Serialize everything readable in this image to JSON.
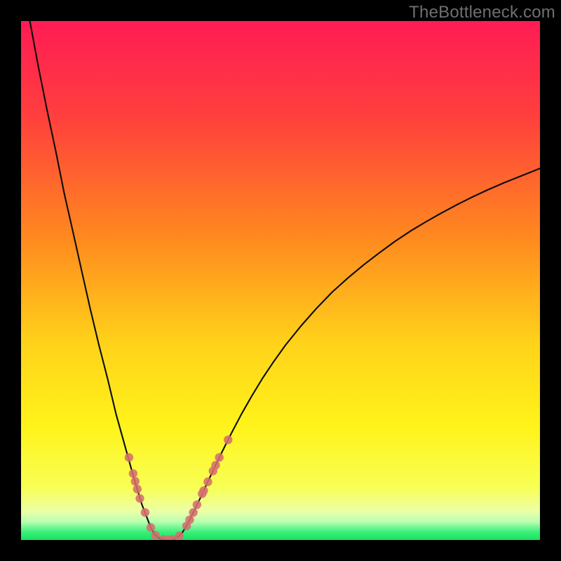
{
  "watermark": "TheBottleneck.com",
  "colors": {
    "bg_black": "#000000",
    "curve": "#0c0c0c",
    "dot": "#d56e6e",
    "green_band": "#1be25d",
    "watermark": "#6f6f6f",
    "gradient_stops": [
      {
        "offset": 0.0,
        "color": "#ff1c55"
      },
      {
        "offset": 0.18,
        "color": "#ff3e3d"
      },
      {
        "offset": 0.42,
        "color": "#ff8a1f"
      },
      {
        "offset": 0.62,
        "color": "#ffd21a"
      },
      {
        "offset": 0.78,
        "color": "#fff31a"
      },
      {
        "offset": 0.9,
        "color": "#f8ff55"
      },
      {
        "offset": 0.945,
        "color": "#ecffa8"
      },
      {
        "offset": 0.965,
        "color": "#b8ffb0"
      },
      {
        "offset": 0.985,
        "color": "#37f07a"
      },
      {
        "offset": 1.0,
        "color": "#1be25d"
      }
    ]
  },
  "chart_data": {
    "type": "line",
    "title": "",
    "xlabel": "",
    "ylabel": "",
    "x": [
      0.0,
      0.017,
      0.033,
      0.05,
      0.067,
      0.083,
      0.1,
      0.117,
      0.133,
      0.15,
      0.167,
      0.183,
      0.2,
      0.217,
      0.233,
      0.25,
      0.258,
      0.267,
      0.275,
      0.283,
      0.292,
      0.3,
      0.31,
      0.32,
      0.33,
      0.345,
      0.365,
      0.385,
      0.405,
      0.425,
      0.445,
      0.465,
      0.485,
      0.51,
      0.54,
      0.57,
      0.6,
      0.63,
      0.66,
      0.69,
      0.72,
      0.75,
      0.78,
      0.81,
      0.84,
      0.87,
      0.9,
      0.93,
      0.96,
      1.0
    ],
    "y_bottleneck": [
      1.09,
      1.0,
      0.914,
      0.829,
      0.749,
      0.669,
      0.594,
      0.518,
      0.447,
      0.376,
      0.31,
      0.243,
      0.182,
      0.121,
      0.068,
      0.024,
      0.01,
      0.003,
      0.001,
      0.0,
      0.001,
      0.004,
      0.013,
      0.029,
      0.049,
      0.08,
      0.123,
      0.165,
      0.205,
      0.243,
      0.278,
      0.311,
      0.341,
      0.376,
      0.413,
      0.447,
      0.478,
      0.505,
      0.53,
      0.553,
      0.575,
      0.595,
      0.613,
      0.63,
      0.646,
      0.661,
      0.675,
      0.688,
      0.7,
      0.716
    ],
    "xlim": [
      0,
      1
    ],
    "ylim": [
      0,
      1
    ],
    "optimum_x": 0.283,
    "scatter_points": [
      {
        "x": 0.208,
        "y": 0.159
      },
      {
        "x": 0.216,
        "y": 0.128
      },
      {
        "x": 0.22,
        "y": 0.113
      },
      {
        "x": 0.224,
        "y": 0.098
      },
      {
        "x": 0.229,
        "y": 0.08
      },
      {
        "x": 0.239,
        "y": 0.053
      },
      {
        "x": 0.25,
        "y": 0.024
      },
      {
        "x": 0.259,
        "y": 0.009
      },
      {
        "x": 0.274,
        "y": 0.001
      },
      {
        "x": 0.283,
        "y": 0.0
      },
      {
        "x": 0.292,
        "y": 0.001
      },
      {
        "x": 0.305,
        "y": 0.008
      },
      {
        "x": 0.319,
        "y": 0.027
      },
      {
        "x": 0.325,
        "y": 0.039
      },
      {
        "x": 0.332,
        "y": 0.053
      },
      {
        "x": 0.339,
        "y": 0.068
      },
      {
        "x": 0.349,
        "y": 0.089
      },
      {
        "x": 0.352,
        "y": 0.095
      },
      {
        "x": 0.36,
        "y": 0.112
      },
      {
        "x": 0.37,
        "y": 0.133
      },
      {
        "x": 0.375,
        "y": 0.144
      },
      {
        "x": 0.382,
        "y": 0.159
      },
      {
        "x": 0.399,
        "y": 0.193
      }
    ]
  }
}
